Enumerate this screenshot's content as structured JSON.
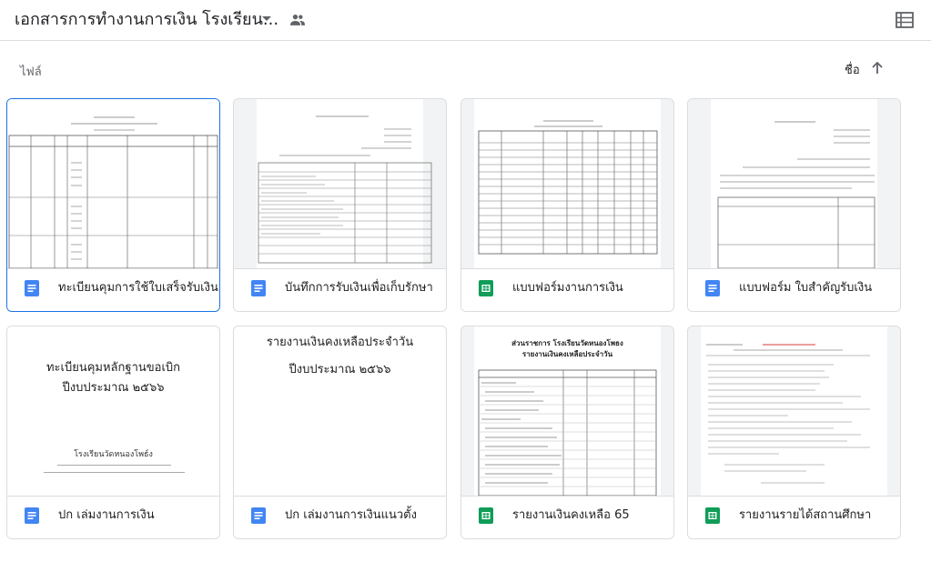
{
  "header": {
    "title": "เอกสารการทำงานการเงิน โรงเรียน...",
    "dropdown_icon": "caret-down-icon",
    "shared_icon": "people-icon",
    "view_toggle_icon": "list-view-icon"
  },
  "section": {
    "label": "ไฟล์",
    "sort_label": "ชื่อ",
    "sort_icon": "arrow-up-icon"
  },
  "colors": {
    "docs_blue": "#4285f4",
    "sheets_green": "#0f9d58",
    "selected_border": "#1a73e8"
  },
  "files": [
    {
      "name": "ทะเบียนคุมการใช้ใบเสร็จรับเงิน",
      "type": "doc",
      "selected": true
    },
    {
      "name": "บันทึกการรับเงินเพื่อเก็บรักษา",
      "type": "doc"
    },
    {
      "name": "แบบฟอร์มงานการเงิน",
      "type": "sheet"
    },
    {
      "name": "แบบฟอร์ม ใบสำคัญรับเงิน",
      "type": "doc"
    },
    {
      "name": "ปก เล่มงานการเงิน",
      "type": "doc",
      "preview": {
        "line1": "ทะเบียนคุมหลักฐานขอเบิก",
        "line2": "ปีงบประมาณ ๒๕๖๖",
        "line3": "โรงเรียนวัดหนองโพธ์ง"
      }
    },
    {
      "name": "ปก เล่มงานการเงินแนวตั้ง",
      "type": "doc",
      "preview": {
        "line1": "รายงานเงินคงเหลือประจำวัน",
        "line2": "ปีงบประมาณ ๒๕๖๖"
      }
    },
    {
      "name": "รายงานเงินคงเหลือ 65",
      "type": "sheet",
      "preview": {
        "line1": "ส่วนราชการ โรงเรียนวัดหนองโพธง",
        "line2": "รายงานเงินคงเหลือประจำวัน"
      }
    },
    {
      "name": "รายงานรายได้สถานศึกษา",
      "type": "sheet"
    }
  ]
}
